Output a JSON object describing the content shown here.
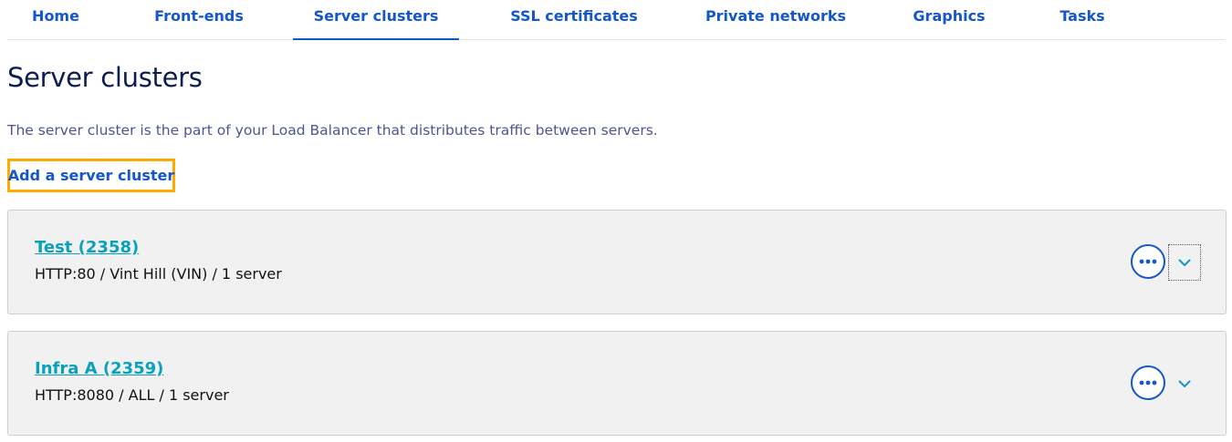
{
  "tabs": [
    {
      "label": "Home"
    },
    {
      "label": "Front-ends"
    },
    {
      "label": "Server clusters",
      "active": true
    },
    {
      "label": "SSL certificates"
    },
    {
      "label": "Private networks"
    },
    {
      "label": "Graphics"
    },
    {
      "label": "Tasks"
    }
  ],
  "page": {
    "title": "Server clusters",
    "description": "The server cluster is the part of your Load Balancer that distributes traffic between servers.",
    "add_button": "Add a server cluster"
  },
  "clusters": [
    {
      "name": "Test (2358)",
      "meta": "HTTP:80 / Vint Hill (VIN) / 1 server"
    },
    {
      "name": "Infra A (2359)",
      "meta": "HTTP:8080 / ALL / 1 server"
    }
  ],
  "icons": {
    "more": "more-options-icon",
    "expand": "chevron-down-icon"
  },
  "colors": {
    "link": "#1457c8",
    "accent": "#0aa2ba",
    "focus_outline": "#ffaa00",
    "title": "#0b1e50"
  }
}
